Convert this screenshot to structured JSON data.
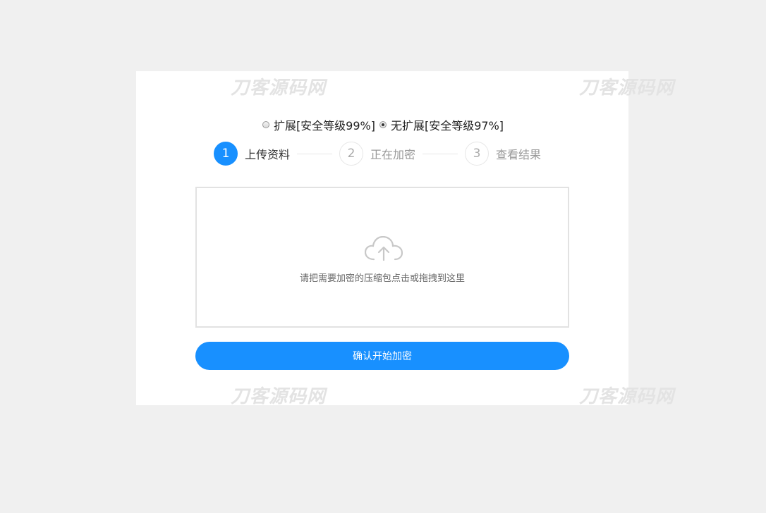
{
  "watermark": {
    "text": "刀客源码网"
  },
  "mode_options": [
    {
      "label": "扩展[安全等级99%]",
      "checked": false
    },
    {
      "label": "无扩展[安全等级97%]",
      "checked": true
    }
  ],
  "steps": [
    {
      "number": "1",
      "label": "上传资料",
      "active": true
    },
    {
      "number": "2",
      "label": "正在加密",
      "active": false
    },
    {
      "number": "3",
      "label": "查看结果",
      "active": false
    }
  ],
  "dropzone": {
    "icon": "cloud-upload-icon",
    "text": "请把需要加密的压缩包点击或拖拽到这里"
  },
  "confirm_button": {
    "label": "确认开始加密"
  },
  "colors": {
    "accent": "#1890ff",
    "background": "#f0f0f0"
  }
}
